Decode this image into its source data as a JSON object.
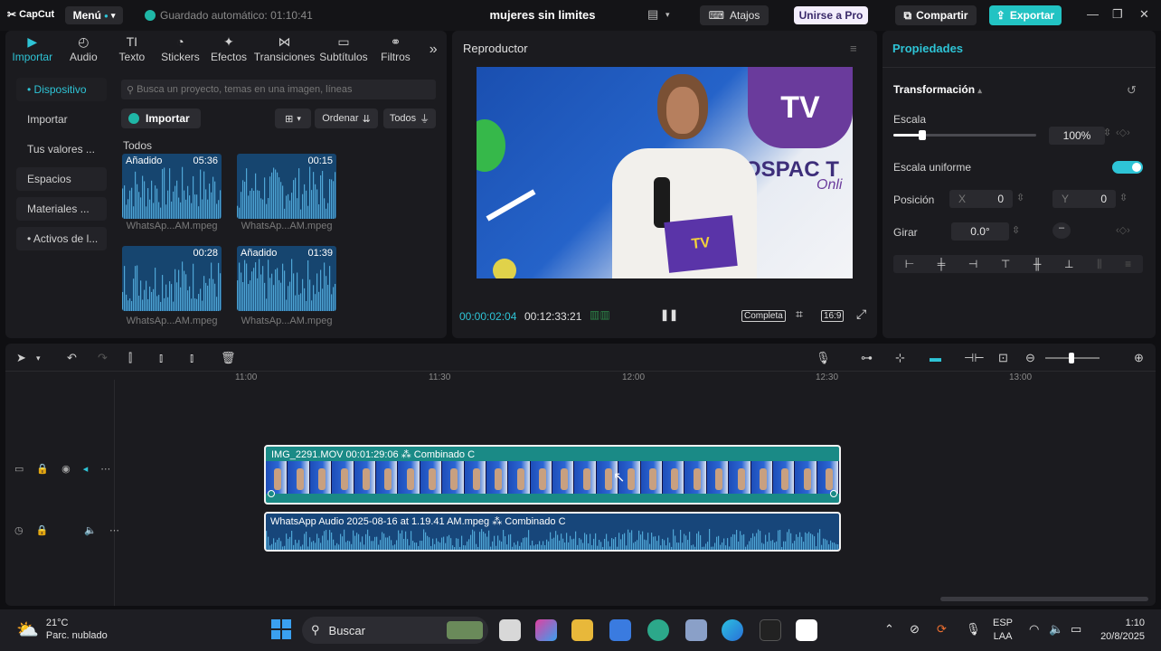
{
  "app": {
    "logo": "CapCut",
    "menu_label": "Menú",
    "autosave": "Guardado automático: 01:10:41",
    "project_name": "mujeres sin limites",
    "shortcuts_label": "Atajos",
    "pro_label": "Unirse a Pro",
    "share_label": "Compartir",
    "export_label": "Exportar"
  },
  "media_tabs": [
    {
      "label": "Importar",
      "icon": "import-icon"
    },
    {
      "label": "Audio",
      "icon": "audio-icon"
    },
    {
      "label": "Texto",
      "icon": "text-icon"
    },
    {
      "label": "Stickers",
      "icon": "sticker-icon"
    },
    {
      "label": "Efectos",
      "icon": "effects-icon"
    },
    {
      "label": "Transiciones",
      "icon": "transitions-icon"
    },
    {
      "label": "Subtítulos",
      "icon": "subtitles-icon"
    },
    {
      "label": "Filtros",
      "icon": "filters-icon"
    }
  ],
  "sidebar": [
    {
      "label": "• Dispositivo"
    },
    {
      "label": "Importar"
    },
    {
      "label": "Tus valores ..."
    },
    {
      "label": "Espacios"
    },
    {
      "label": "Materiales ..."
    },
    {
      "label": "• Activos de l..."
    }
  ],
  "media": {
    "search_placeholder": "Busca un proyecto, temas en una imagen, líneas",
    "import_label": "Importar",
    "sort_label": "Ordenar",
    "filter_label": "Todos",
    "section_label": "Todos",
    "items": [
      {
        "added": "Añadido",
        "duration": "05:36",
        "name": "WhatsAp...AM.mpeg"
      },
      {
        "added": "",
        "duration": "00:15",
        "name": "WhatsAp...AM.mpeg"
      },
      {
        "added": "",
        "duration": "00:28",
        "name": "WhatsAp...AM.mpeg"
      },
      {
        "added": "Añadido",
        "duration": "01:39",
        "name": "WhatsAp...AM.mpeg"
      }
    ]
  },
  "player": {
    "title": "Reproductor",
    "current_time": "00:00:02:04",
    "total_time": "00:12:33:21",
    "quality_label": "Completa",
    "ratio_label": "16:9",
    "video_overlay_text": "OSPAC T",
    "video_logo_text": "TV",
    "video_script_text": "Onli",
    "card_text": "TV"
  },
  "properties": {
    "title": "Propiedades",
    "section": "Transformación",
    "scale_label": "Escala",
    "scale_value": "100%",
    "scale_level": 0.2,
    "uniform_label": "Escala uniforme",
    "position_label": "Posición",
    "pos_x_label": "X",
    "pos_x": "0",
    "pos_y_label": "Y",
    "pos_y": "0",
    "rotate_label": "Girar",
    "rotate_value": "0.0°"
  },
  "timeline": {
    "ruler": [
      "11:00",
      "11:30",
      "12:00",
      "12:30",
      "13:00"
    ],
    "video_clip_label": "IMG_2291.MOV   00:01:29:06   ⁂ Combinado C",
    "audio_clip_label": "WhatsApp Audio 2025-08-16 at 1.19.41 AM.mpeg   ⁂ Combinado C"
  },
  "taskbar": {
    "temp": "21°C",
    "weather": "Parc. nublado",
    "search_label": "Buscar",
    "lang1": "ESP",
    "lang2": "LAA",
    "time": "1:10",
    "date": "20/8/2025"
  },
  "colors": {
    "accent": "#2ec4d6",
    "export_bg": "#22c3c3",
    "video_clip": "#1a8a86",
    "audio_clip": "#17467a"
  }
}
